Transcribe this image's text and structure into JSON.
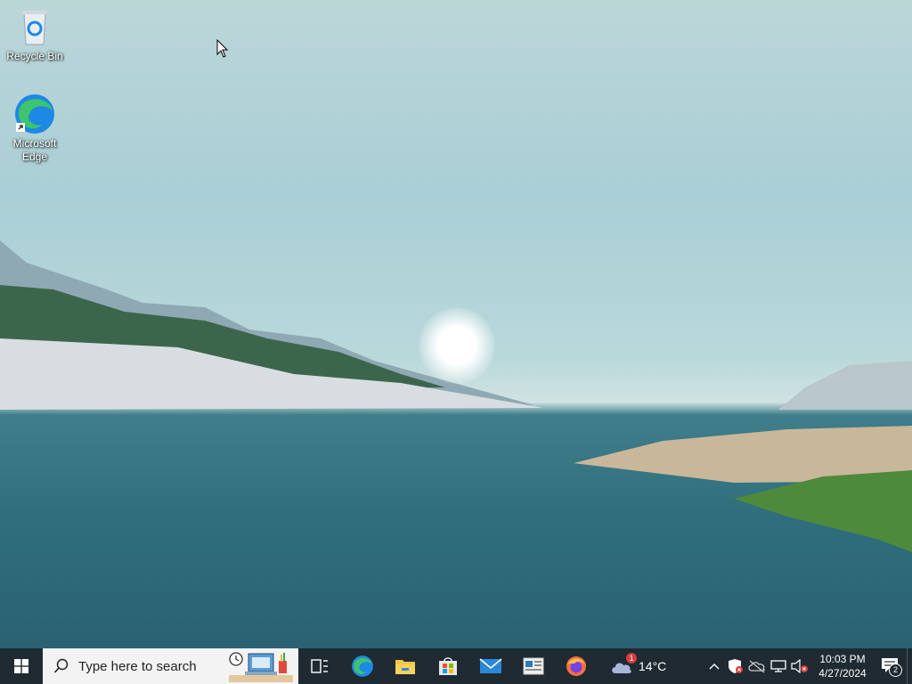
{
  "desktop": {
    "icons": [
      {
        "label": "Recycle Bin",
        "icon": "recycle-bin-icon"
      },
      {
        "label": "Microsoft\nEdge",
        "icon": "edge-icon"
      }
    ],
    "wallpaper": "lake-landscape-with-sun"
  },
  "taskbar": {
    "search_placeholder": "Type here to search",
    "apps": [
      "task-view-icon",
      "edge-icon",
      "file-explorer-icon",
      "microsoft-store-icon",
      "mail-icon",
      "news-icon",
      "firefox-icon"
    ],
    "weather": {
      "temp": "14°C",
      "badge": "1"
    },
    "clock": {
      "time": "10:03 PM",
      "date": "4/27/2024"
    },
    "notifications": "2"
  },
  "colors": {
    "taskbar": "#1f2a33",
    "accent": "#0078d4"
  }
}
